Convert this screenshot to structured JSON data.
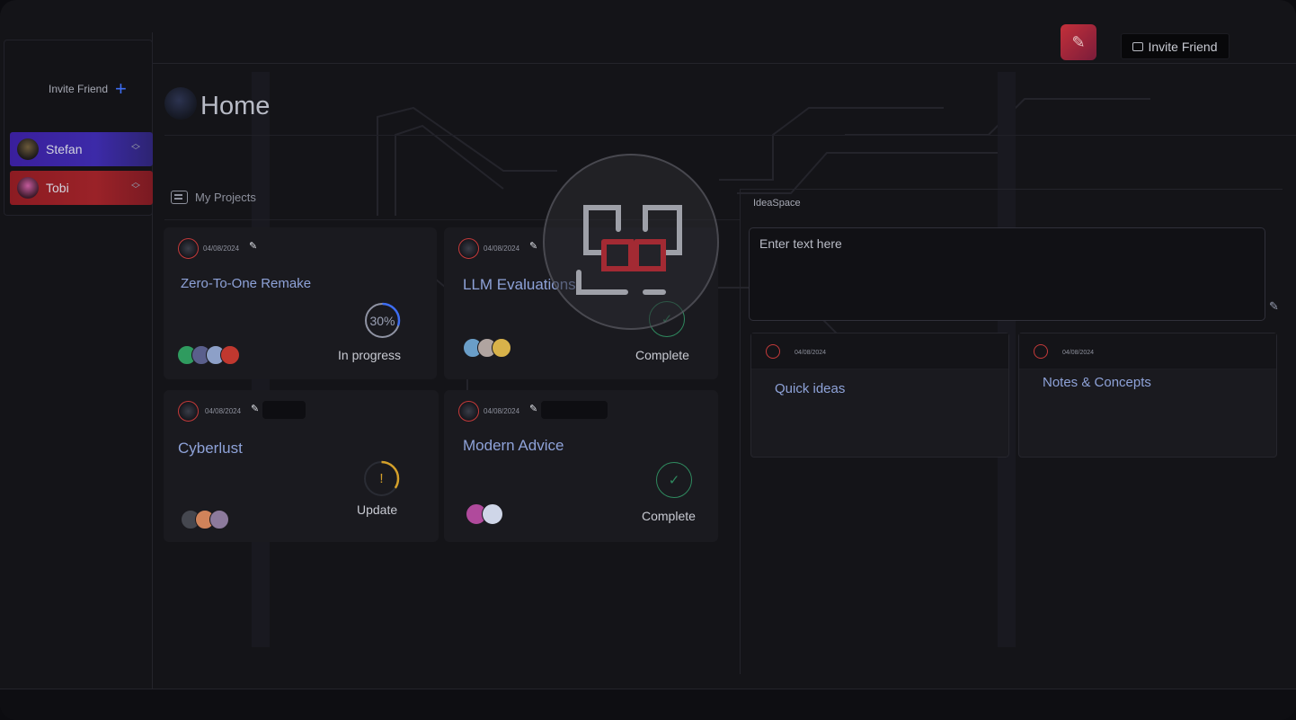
{
  "topbar": {
    "invite_label": "Invite Friend",
    "edit_icon": "pencil-icon"
  },
  "sidebar": {
    "invite_label": "Invite Friend",
    "users": [
      {
        "name": "Stefan",
        "color": "#3c2aa8"
      },
      {
        "name": "Tobi",
        "color": "#9a2228"
      }
    ]
  },
  "home": {
    "title": "Home",
    "projects_label": "My Projects"
  },
  "projects": [
    {
      "title": "Zero-To-One Remake",
      "date": "04/08/2024",
      "status": "In progress",
      "progress_text": "30%",
      "progress": 0.3,
      "status_color": "#3d6df2"
    },
    {
      "title": "LLM Evaluations",
      "date": "04/08/2024",
      "status": "Complete",
      "status_color": "#2f8a5f"
    },
    {
      "title": "Cyberlust",
      "date": "04/08/2024",
      "status": "Update",
      "status_glyph": "!",
      "status_color": "#d4a02a"
    },
    {
      "title": "Modern Advice",
      "date": "04/08/2024",
      "status": "Complete",
      "status_color": "#2f8a5f"
    }
  ],
  "ideaspace": {
    "label": "IdeaSpace",
    "placeholder": "Enter text here",
    "notes": [
      {
        "title": "Quick ideas",
        "date": "04/08/2024"
      },
      {
        "title": "Notes & Concepts",
        "date": "04/08/2024"
      }
    ]
  }
}
